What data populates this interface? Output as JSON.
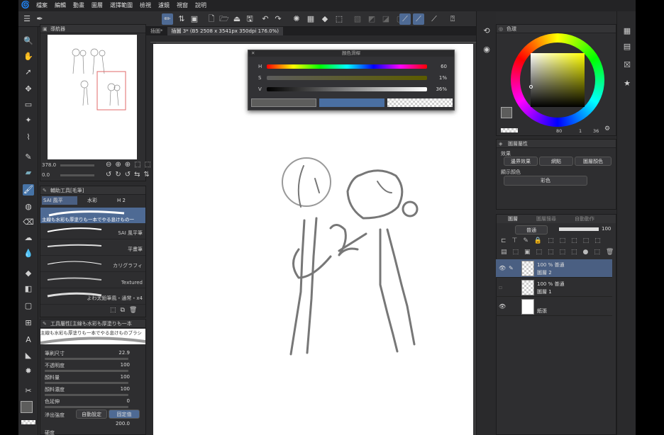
{
  "menu": {
    "logo": "🌀",
    "items": [
      "檔案",
      "編輯",
      "動畫",
      "圖層",
      "選擇範圍",
      "檢視",
      "濾鏡",
      "視窗",
      "說明"
    ]
  },
  "doc_tabs": [
    "插圖*",
    "插圖 3* (B5 2508 x 3541px 350dpi 176.0%)"
  ],
  "navigator": {
    "title": "導航器",
    "zoom": "378.0",
    "angle": "0.0"
  },
  "subtool": {
    "tabs_title": "輔助工具[毛筆]",
    "tab1": "SAI 風平",
    "tab2": "水彩",
    "tab3": "H 2",
    "header_brush": "主線も水彩も厚塗りも一本でやる息けもの一",
    "brushes": [
      "SAI 風平筆",
      "平畫筆",
      "カリグラフィ",
      "Textured",
      "よわ太鉛筆風・通常・x4"
    ]
  },
  "tool_property": {
    "title": "工具屬性[主線も水彩も厚塗りも一本",
    "preview": "主線も水彩も厚塗りも一本でやる息けものブラシ",
    "rows": [
      {
        "label": "筆刷尺寸",
        "value": "22.9"
      },
      {
        "label": "不透明度",
        "value": "100"
      },
      {
        "label": "顏料量",
        "value": "100"
      },
      {
        "label": "顏料濃度",
        "value": "100"
      },
      {
        "label": "色延伸",
        "value": "0"
      }
    ],
    "blend": {
      "label": "滲出強度",
      "auto": "自動設定",
      "fixed": "固定值",
      "value": "200.0"
    },
    "last": "硬度"
  },
  "color_settings": {
    "title": "顏色滑桿",
    "h": {
      "label": "H",
      "value": "60",
      "pct": 0.0
    },
    "s": {
      "label": "S",
      "value": "1%",
      "pct": 0.01
    },
    "v": {
      "label": "V",
      "value": "36%",
      "pct": 0.36
    }
  },
  "color_wheel": {
    "title": "色環",
    "readout": "80",
    "readout2": "1",
    "readout3": "36"
  },
  "layer_prop": {
    "title": "圖層屬性",
    "effect": "效果",
    "border": "邊界效果",
    "tone": "網點",
    "layer_color": "圖層顏色",
    "display_color": "顯示顏色",
    "color_mode": "彩色"
  },
  "layers_panel": {
    "tabs": [
      "圖層",
      "圖層搜尋",
      "自動動作"
    ],
    "blend": "普通",
    "opacity": "100",
    "layers": [
      {
        "mode": "100 % 普通",
        "name": "圖層 2",
        "selected": true
      },
      {
        "mode": "100 % 普通",
        "name": "圖層 1",
        "selected": false
      },
      {
        "mode": "",
        "name": "紙張",
        "selected": false
      }
    ]
  },
  "colors": {
    "accent": "#4673a6",
    "main_color": "#5d5d5c",
    "sub_color": "#4a6fa2"
  }
}
